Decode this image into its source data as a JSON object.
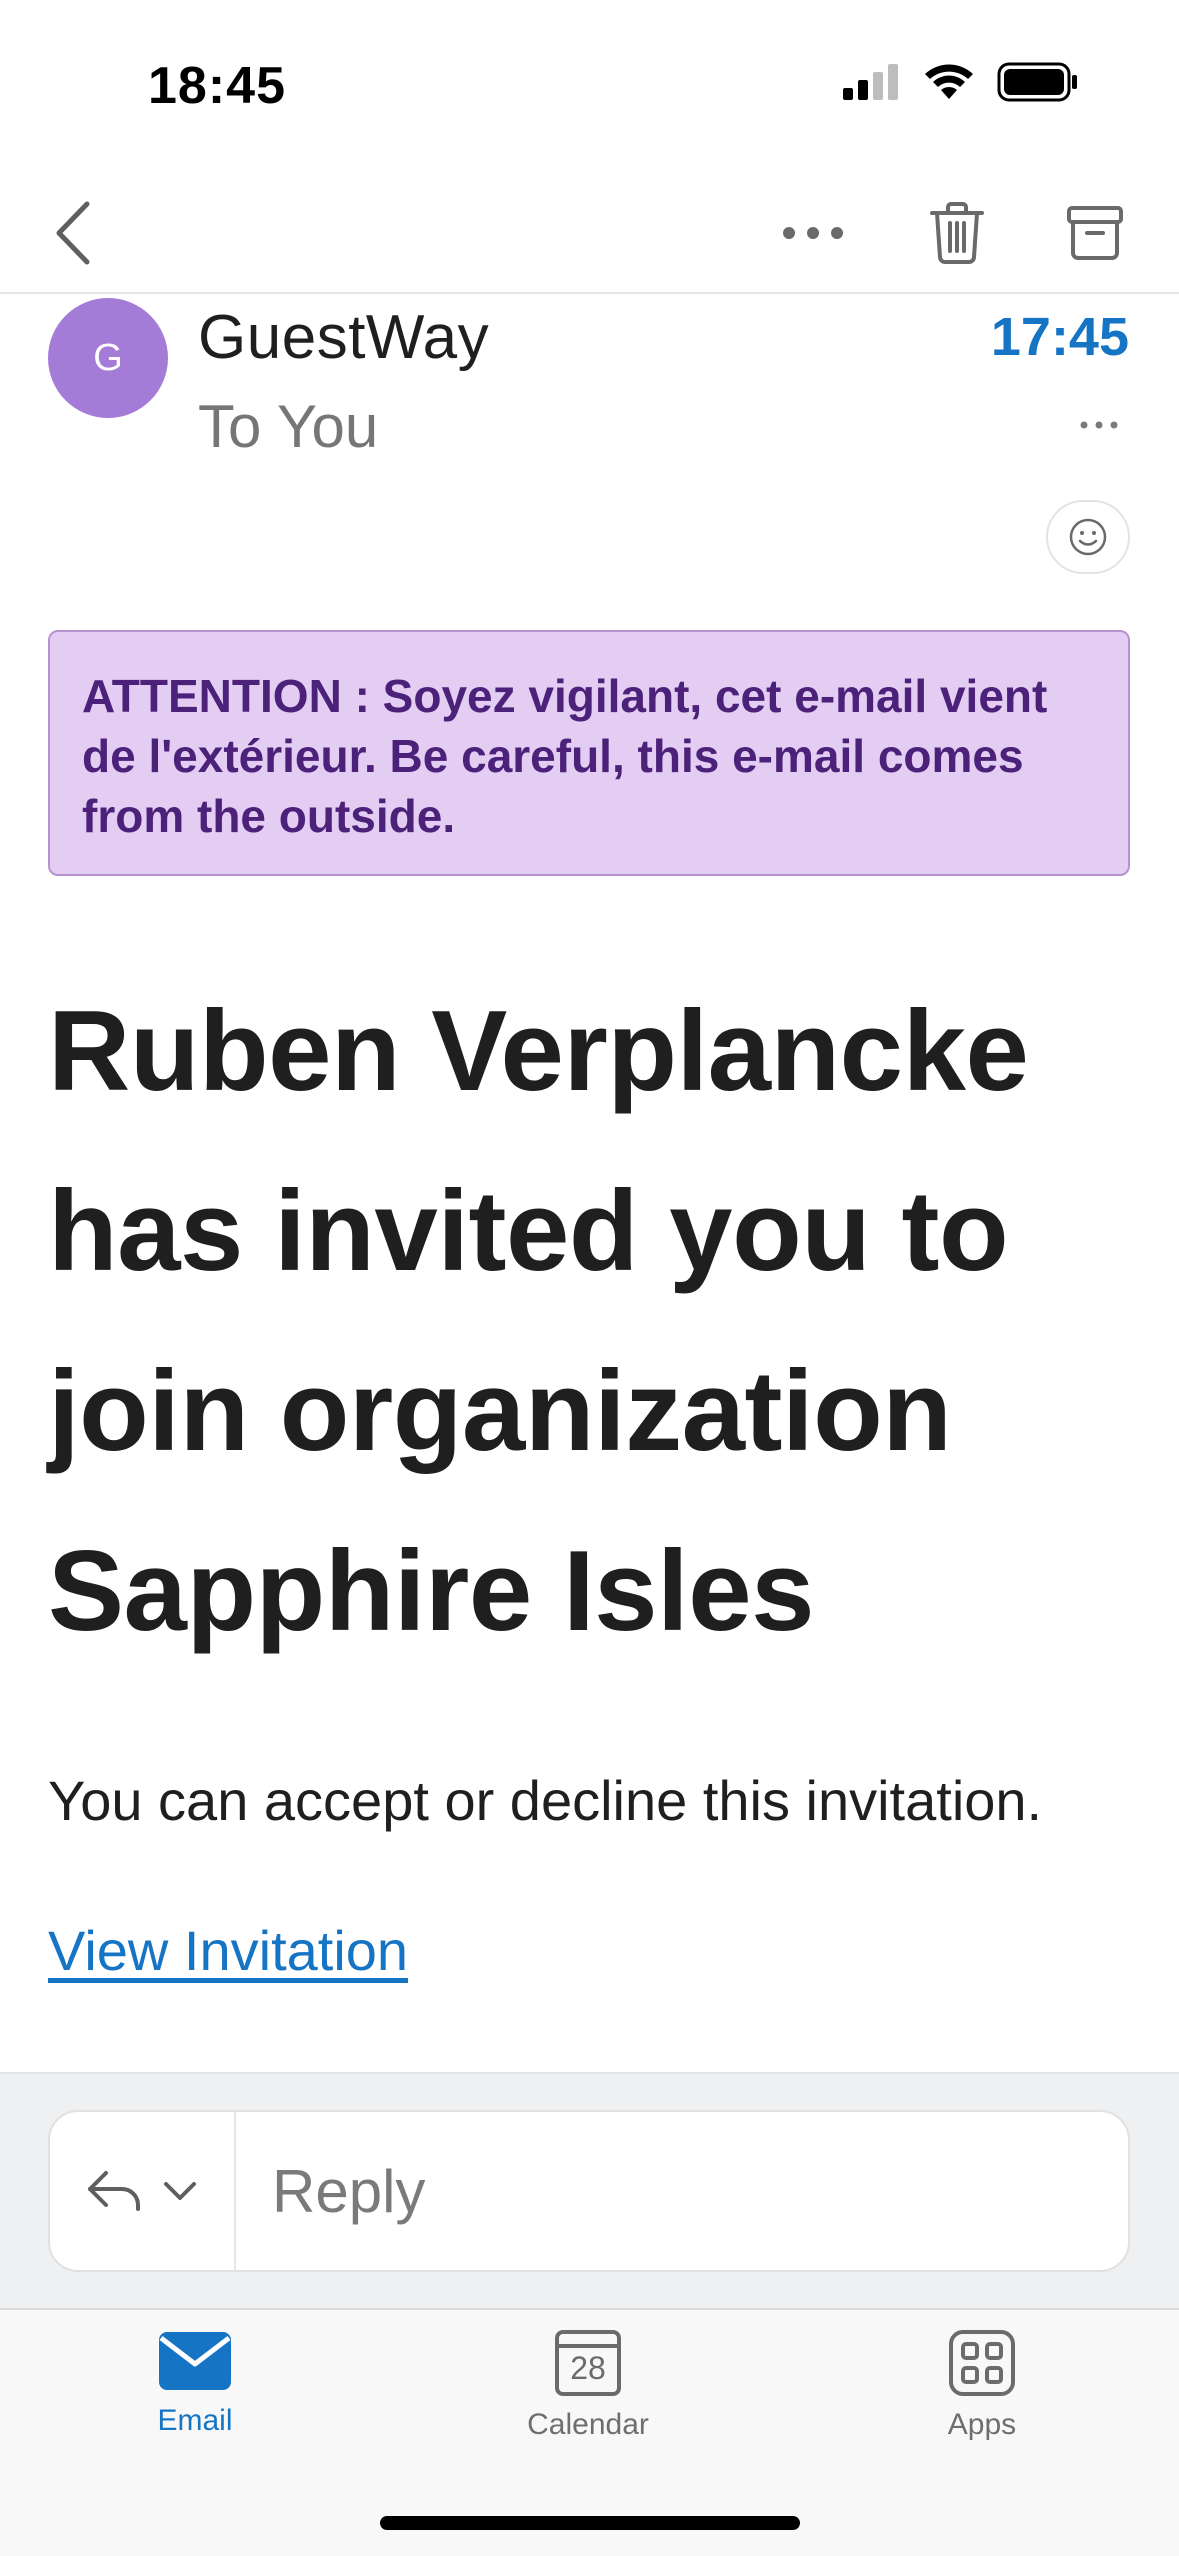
{
  "status_bar": {
    "time": "18:45",
    "icons": [
      "cellular-signal-icon",
      "wifi-icon",
      "battery-icon"
    ]
  },
  "toolbar": {
    "icons": [
      "back-chevron-icon",
      "more-horizontal-icon",
      "trash-icon",
      "archive-icon"
    ]
  },
  "message": {
    "avatar_initial": "G",
    "avatar_color": "#a57bd8",
    "sender": "GuestWay",
    "recipient": "To You",
    "time": "17:45",
    "time_color": "#1574c4"
  },
  "banner": {
    "text": "ATTENTION : Soyez vigilant, cet e-mail vient de l'extérieur. Be careful, this e-mail comes from the outside.",
    "background": "#e3cdf3",
    "text_color": "#4b2179"
  },
  "body": {
    "headline": "Ruben Verplancke has invited you to join organization Sapphire Isles",
    "text": "You can accept or decline this invitation.",
    "link_text": "View Invitation",
    "link_color": "#1574c4"
  },
  "reply": {
    "placeholder": "Reply"
  },
  "tab_bar": {
    "tabs": [
      {
        "label": "Email",
        "icon": "mail-icon",
        "active": true
      },
      {
        "label": "Calendar",
        "icon": "calendar-icon",
        "day": "28",
        "active": false
      },
      {
        "label": "Apps",
        "icon": "apps-grid-icon",
        "active": false
      }
    ],
    "active_color": "#1574c4"
  }
}
